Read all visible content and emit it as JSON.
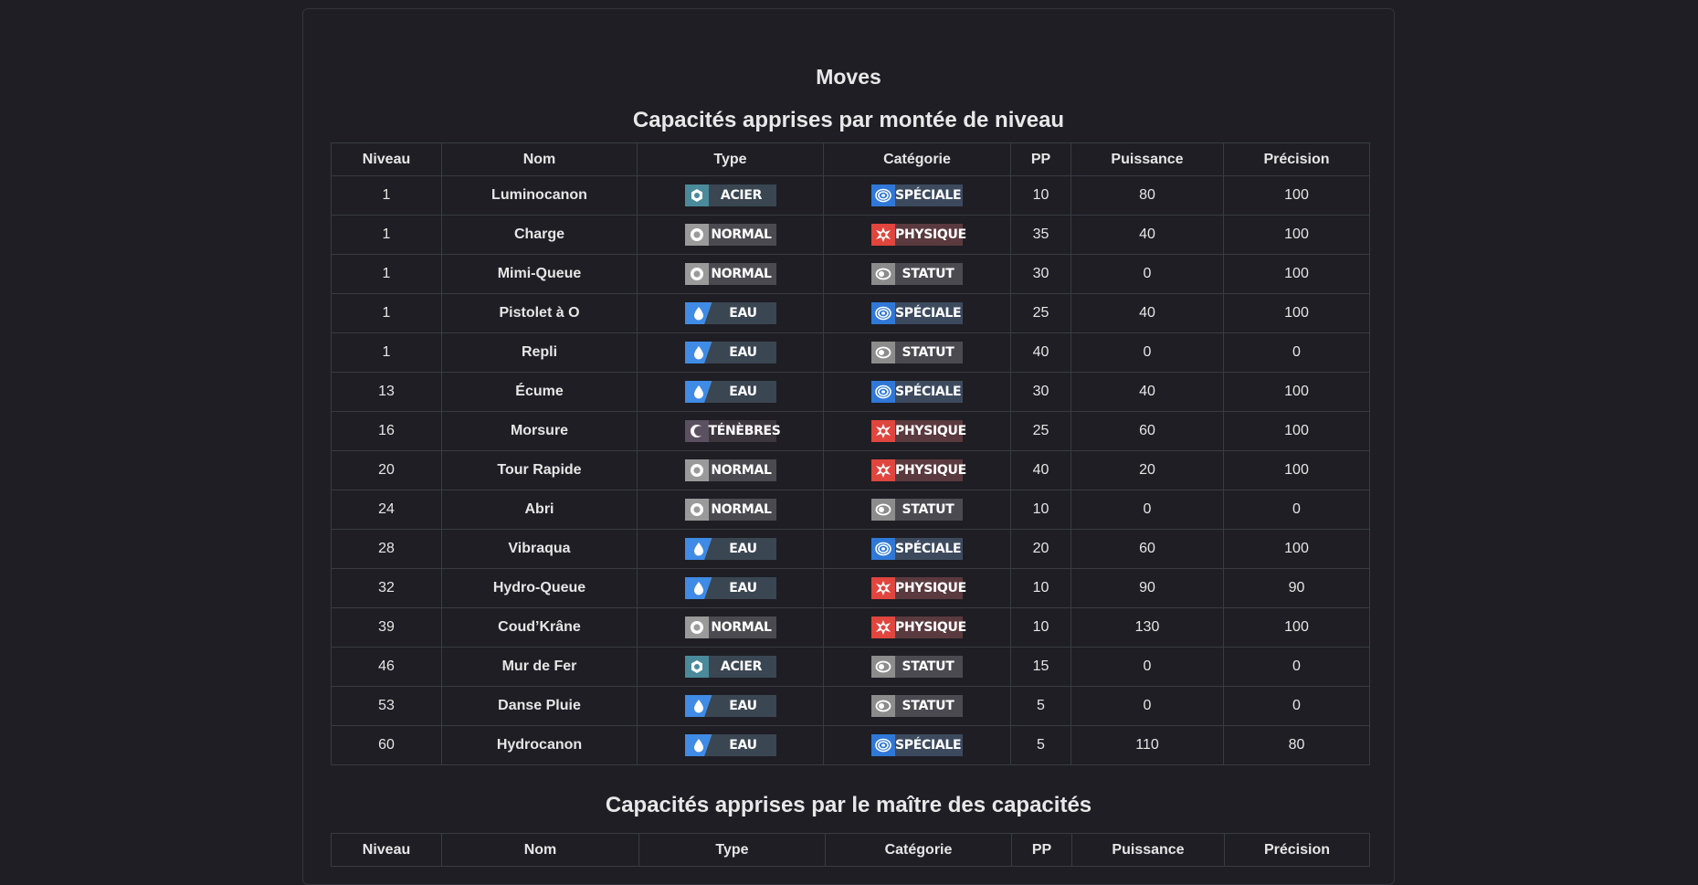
{
  "page": {
    "title": "Moves",
    "level_section_title": "Capacités apprises par montée de niveau",
    "tm_section_title": "Capacités apprises par le maître des capacités"
  },
  "colors": {
    "background": "#1e1e24",
    "steel": "#4a8a9a",
    "normal": "#9a9a9a",
    "water": "#3f8be6",
    "dark": "#5a5060",
    "special": "#2f78d8",
    "physical": "#e0453e",
    "status": "#8c8c8c"
  },
  "headers": [
    "Niveau",
    "Nom",
    "Type",
    "Catégorie",
    "PP",
    "Puissance",
    "Précision"
  ],
  "level_moves": [
    {
      "niveau": "1",
      "nom": "Luminocanon",
      "type": "ACIER",
      "type_icon": "steel-icon",
      "categorie": "SPÉCIALE",
      "cat_icon": "special-icon",
      "pp": "10",
      "puissance": "80",
      "precision": "100"
    },
    {
      "niveau": "1",
      "nom": "Charge",
      "type": "NORMAL",
      "type_icon": "normal-icon",
      "categorie": "PHYSIQUE",
      "cat_icon": "physical-icon",
      "pp": "35",
      "puissance": "40",
      "precision": "100"
    },
    {
      "niveau": "1",
      "nom": "Mimi-Queue",
      "type": "NORMAL",
      "type_icon": "normal-icon",
      "categorie": "STATUT",
      "cat_icon": "status-icon",
      "pp": "30",
      "puissance": "0",
      "precision": "100"
    },
    {
      "niveau": "1",
      "nom": "Pistolet à O",
      "type": "EAU",
      "type_icon": "water-icon",
      "categorie": "SPÉCIALE",
      "cat_icon": "special-icon",
      "pp": "25",
      "puissance": "40",
      "precision": "100"
    },
    {
      "niveau": "1",
      "nom": "Repli",
      "type": "EAU",
      "type_icon": "water-icon",
      "categorie": "STATUT",
      "cat_icon": "status-icon",
      "pp": "40",
      "puissance": "0",
      "precision": "0"
    },
    {
      "niveau": "13",
      "nom": "Écume",
      "type": "EAU",
      "type_icon": "water-icon",
      "categorie": "SPÉCIALE",
      "cat_icon": "special-icon",
      "pp": "30",
      "puissance": "40",
      "precision": "100"
    },
    {
      "niveau": "16",
      "nom": "Morsure",
      "type": "TÉNÈBRES",
      "type_icon": "dark-icon",
      "categorie": "PHYSIQUE",
      "cat_icon": "physical-icon",
      "pp": "25",
      "puissance": "60",
      "precision": "100"
    },
    {
      "niveau": "20",
      "nom": "Tour Rapide",
      "type": "NORMAL",
      "type_icon": "normal-icon",
      "categorie": "PHYSIQUE",
      "cat_icon": "physical-icon",
      "pp": "40",
      "puissance": "20",
      "precision": "100"
    },
    {
      "niveau": "24",
      "nom": "Abri",
      "type": "NORMAL",
      "type_icon": "normal-icon",
      "categorie": "STATUT",
      "cat_icon": "status-icon",
      "pp": "10",
      "puissance": "0",
      "precision": "0"
    },
    {
      "niveau": "28",
      "nom": "Vibraqua",
      "type": "EAU",
      "type_icon": "water-icon",
      "categorie": "SPÉCIALE",
      "cat_icon": "special-icon",
      "pp": "20",
      "puissance": "60",
      "precision": "100"
    },
    {
      "niveau": "32",
      "nom": "Hydro-Queue",
      "type": "EAU",
      "type_icon": "water-icon",
      "categorie": "PHYSIQUE",
      "cat_icon": "physical-icon",
      "pp": "10",
      "puissance": "90",
      "precision": "90"
    },
    {
      "niveau": "39",
      "nom": "Coud’Krâne",
      "type": "NORMAL",
      "type_icon": "normal-icon",
      "categorie": "PHYSIQUE",
      "cat_icon": "physical-icon",
      "pp": "10",
      "puissance": "130",
      "precision": "100"
    },
    {
      "niveau": "46",
      "nom": "Mur de Fer",
      "type": "ACIER",
      "type_icon": "steel-icon",
      "categorie": "STATUT",
      "cat_icon": "status-icon",
      "pp": "15",
      "puissance": "0",
      "precision": "0"
    },
    {
      "niveau": "53",
      "nom": "Danse Pluie",
      "type": "EAU",
      "type_icon": "water-icon",
      "categorie": "STATUT",
      "cat_icon": "status-icon",
      "pp": "5",
      "puissance": "0",
      "precision": "0"
    },
    {
      "niveau": "60",
      "nom": "Hydrocanon",
      "type": "EAU",
      "type_icon": "water-icon",
      "categorie": "SPÉCIALE",
      "cat_icon": "special-icon",
      "pp": "5",
      "puissance": "110",
      "precision": "80"
    }
  ]
}
